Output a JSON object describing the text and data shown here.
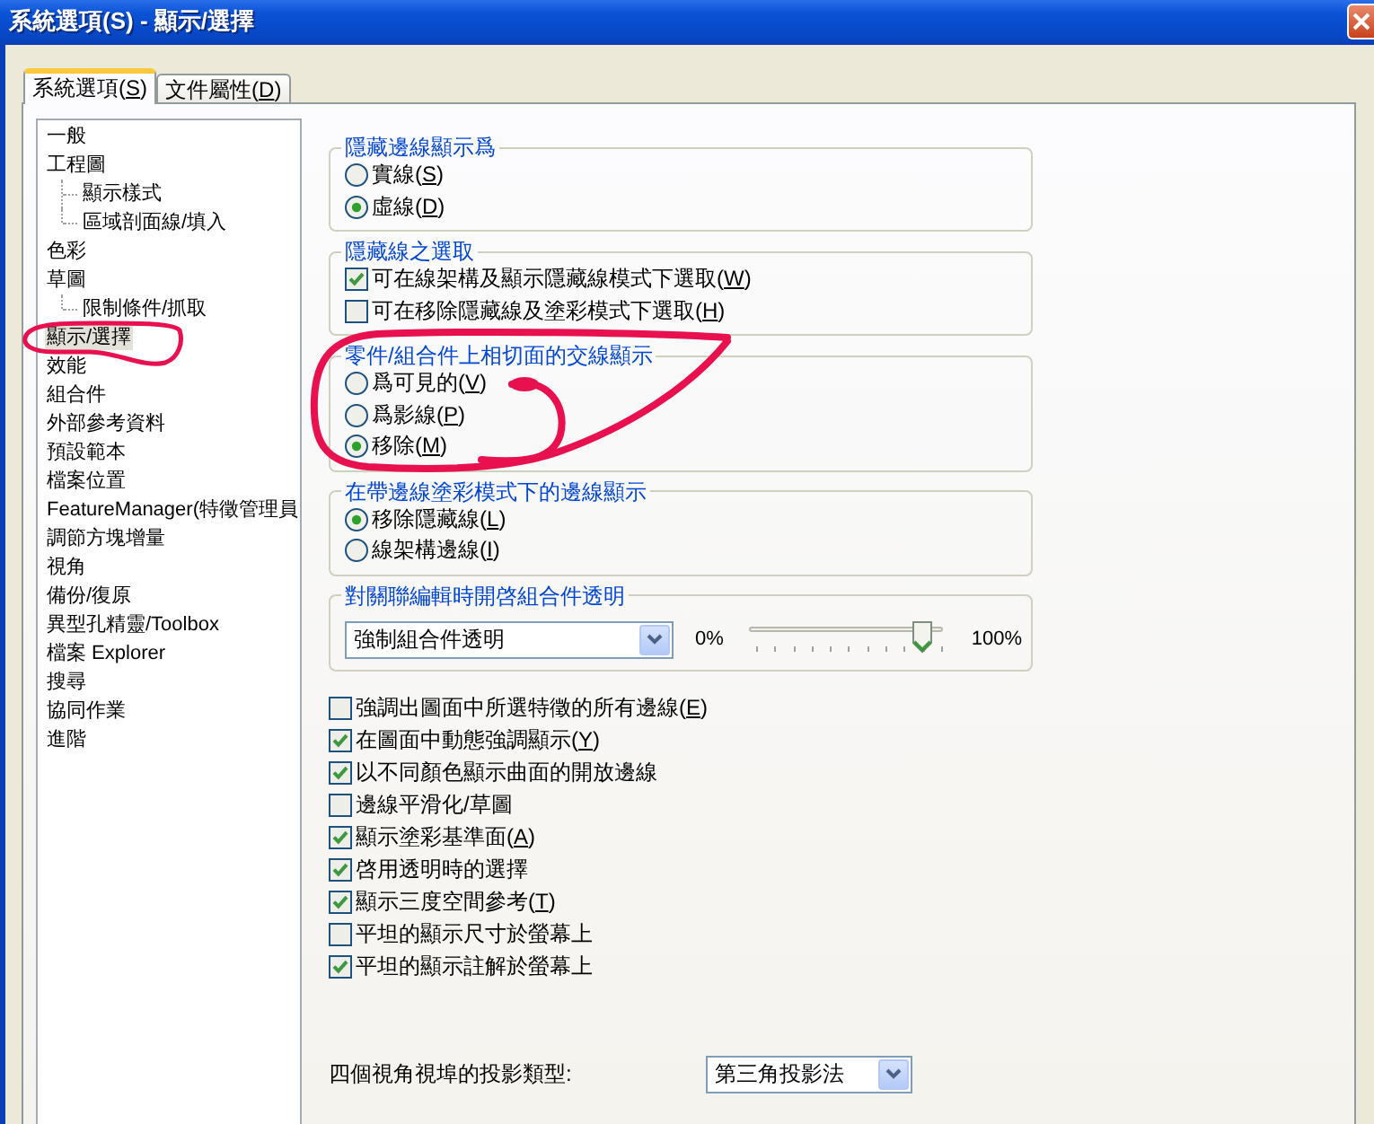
{
  "window": {
    "title": "系統選項(S) - 顯示/選擇"
  },
  "tabs": [
    {
      "label": "系統選項(S)",
      "selected": true
    },
    {
      "label": "文件屬性(D)",
      "selected": false
    }
  ],
  "sidebar": {
    "items": [
      {
        "label": "一般",
        "selected": false
      },
      {
        "label": "工程圖",
        "selected": false,
        "children": [
          {
            "label": "顯示樣式",
            "selected": false
          },
          {
            "label": "區域剖面線/填入",
            "selected": false
          }
        ]
      },
      {
        "label": "色彩",
        "selected": false
      },
      {
        "label": "草圖",
        "selected": false,
        "children": [
          {
            "label": "限制條件/抓取",
            "selected": false
          }
        ]
      },
      {
        "label": "顯示/選擇",
        "selected": true
      },
      {
        "label": "效能",
        "selected": false
      },
      {
        "label": "組合件",
        "selected": false
      },
      {
        "label": "外部參考資料",
        "selected": false
      },
      {
        "label": "預設範本",
        "selected": false
      },
      {
        "label": "檔案位置",
        "selected": false
      },
      {
        "label": "FeatureManager(特徵管理員",
        "selected": false
      },
      {
        "label": "調節方塊增量",
        "selected": false
      },
      {
        "label": "視角",
        "selected": false
      },
      {
        "label": "備份/復原",
        "selected": false
      },
      {
        "label": "異型孔精靈/Toolbox",
        "selected": false
      },
      {
        "label": "檔案 Explorer",
        "selected": false
      },
      {
        "label": "搜尋",
        "selected": false
      },
      {
        "label": "協同作業",
        "selected": false
      },
      {
        "label": "進階",
        "selected": false
      }
    ]
  },
  "groups": [
    {
      "title": "隱藏邊線顯示爲",
      "options": [
        {
          "kind": "radio",
          "label": "實線(S)",
          "selected": false
        },
        {
          "kind": "radio",
          "label": "虛線(D)",
          "selected": true
        }
      ]
    },
    {
      "title": "隱藏線之選取",
      "options": [
        {
          "kind": "checkbox",
          "label": "可在線架構及顯示隱藏線模式下選取(W)",
          "checked": true
        },
        {
          "kind": "checkbox",
          "label": "可在移除隱藏線及塗彩模式下選取(H)",
          "checked": false
        }
      ]
    },
    {
      "title": "零件/組合件上相切面的交線顯示",
      "options": [
        {
          "kind": "radio",
          "label": "爲可見的(V)",
          "selected": false
        },
        {
          "kind": "radio",
          "label": "爲影線(P)",
          "selected": false
        },
        {
          "kind": "radio",
          "label": "移除(M)",
          "selected": true
        }
      ]
    },
    {
      "title": "在帶邊線塗彩模式下的邊線顯示",
      "options": [
        {
          "kind": "radio",
          "label": "移除隱藏線(L)",
          "selected": true
        },
        {
          "kind": "radio",
          "label": "線架構邊線(I)",
          "selected": false
        }
      ]
    },
    {
      "title": "對關聯編輯時開啓組合件透明",
      "dropdown": {
        "value": "強制組合件透明"
      },
      "slider": {
        "min_label": "0%",
        "max_label": "100%",
        "level": 0.9
      }
    }
  ],
  "checkboxes": [
    {
      "label": "強調出圖面中所選特徵的所有邊線(E)",
      "checked": false
    },
    {
      "label": "在圖面中動態強調顯示(Y)",
      "checked": true
    },
    {
      "label": "以不同顏色顯示曲面的開放邊線",
      "checked": true
    },
    {
      "label": "邊線平滑化/草圖",
      "checked": false
    },
    {
      "label": "顯示塗彩基準面(A)",
      "checked": true
    },
    {
      "label": "啓用透明時的選擇",
      "checked": true
    },
    {
      "label": "顯示三度空間參考(T)",
      "checked": true
    },
    {
      "label": "平坦的顯示尺寸於螢幕上",
      "checked": false
    },
    {
      "label": "平坦的顯示註解於螢幕上",
      "checked": true
    }
  ],
  "projection": {
    "label": "四個視角視埠的投影類型:",
    "value": "第三角投影法"
  }
}
